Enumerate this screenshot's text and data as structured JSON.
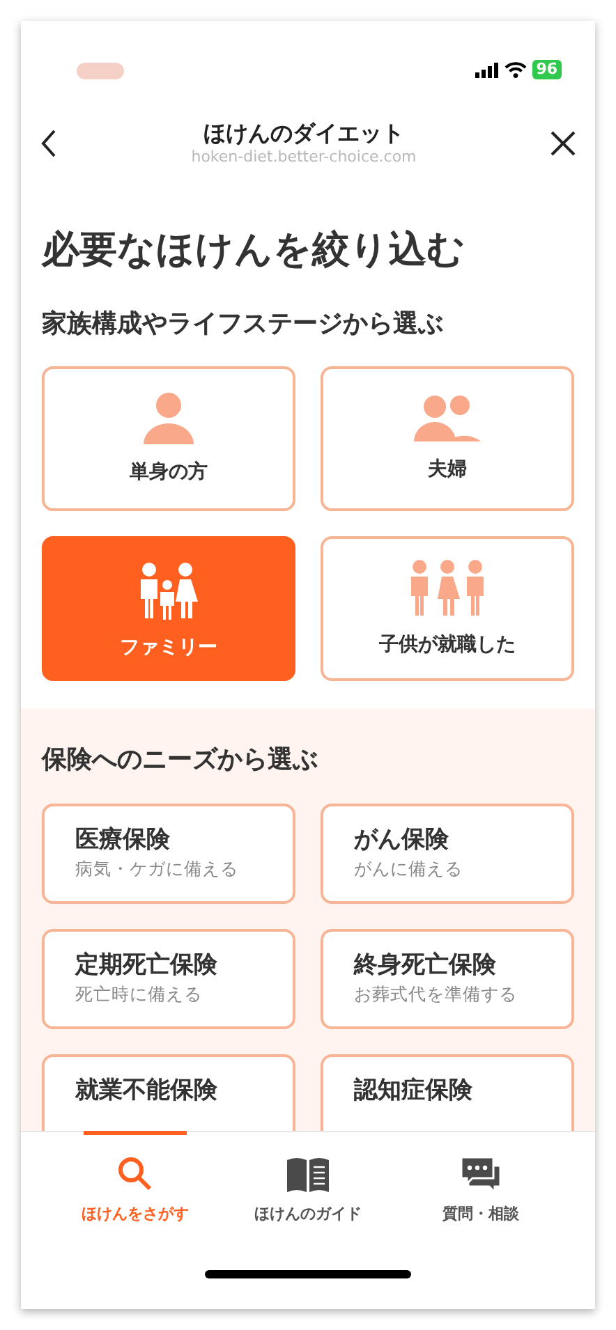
{
  "status_bar": {
    "battery": "96"
  },
  "header": {
    "title": "ほけんのダイエット",
    "url": "hoken-diet.better-choice.com"
  },
  "heading": "必要なほけんを絞り込む",
  "life_stage": {
    "heading": "家族構成やライフステージから選ぶ",
    "options": [
      {
        "label": "単身の方",
        "kind": "single",
        "selected": false
      },
      {
        "label": "夫婦",
        "kind": "couple",
        "selected": false
      },
      {
        "label": "ファミリー",
        "kind": "family",
        "selected": true
      },
      {
        "label": "子供が就職した",
        "kind": "grown",
        "selected": false
      }
    ]
  },
  "needs": {
    "heading": "保険へのニーズから選ぶ",
    "items": [
      {
        "title": "医療保険",
        "subtitle": "病気・ケガに備える"
      },
      {
        "title": "がん保険",
        "subtitle": "がんに備える"
      },
      {
        "title": "定期死亡保険",
        "subtitle": "死亡時に備える"
      },
      {
        "title": "終身死亡保険",
        "subtitle": "お葬式代を準備する"
      },
      {
        "title": "就業不能保険"
      },
      {
        "title": "認知症保険"
      }
    ]
  },
  "bottom_nav": [
    {
      "label": "ほけんをさがす",
      "kind": "search",
      "selected": true
    },
    {
      "label": "ほけんのガイド",
      "kind": "guide",
      "selected": false
    },
    {
      "label": "質問・相談",
      "kind": "chat",
      "selected": false
    }
  ]
}
